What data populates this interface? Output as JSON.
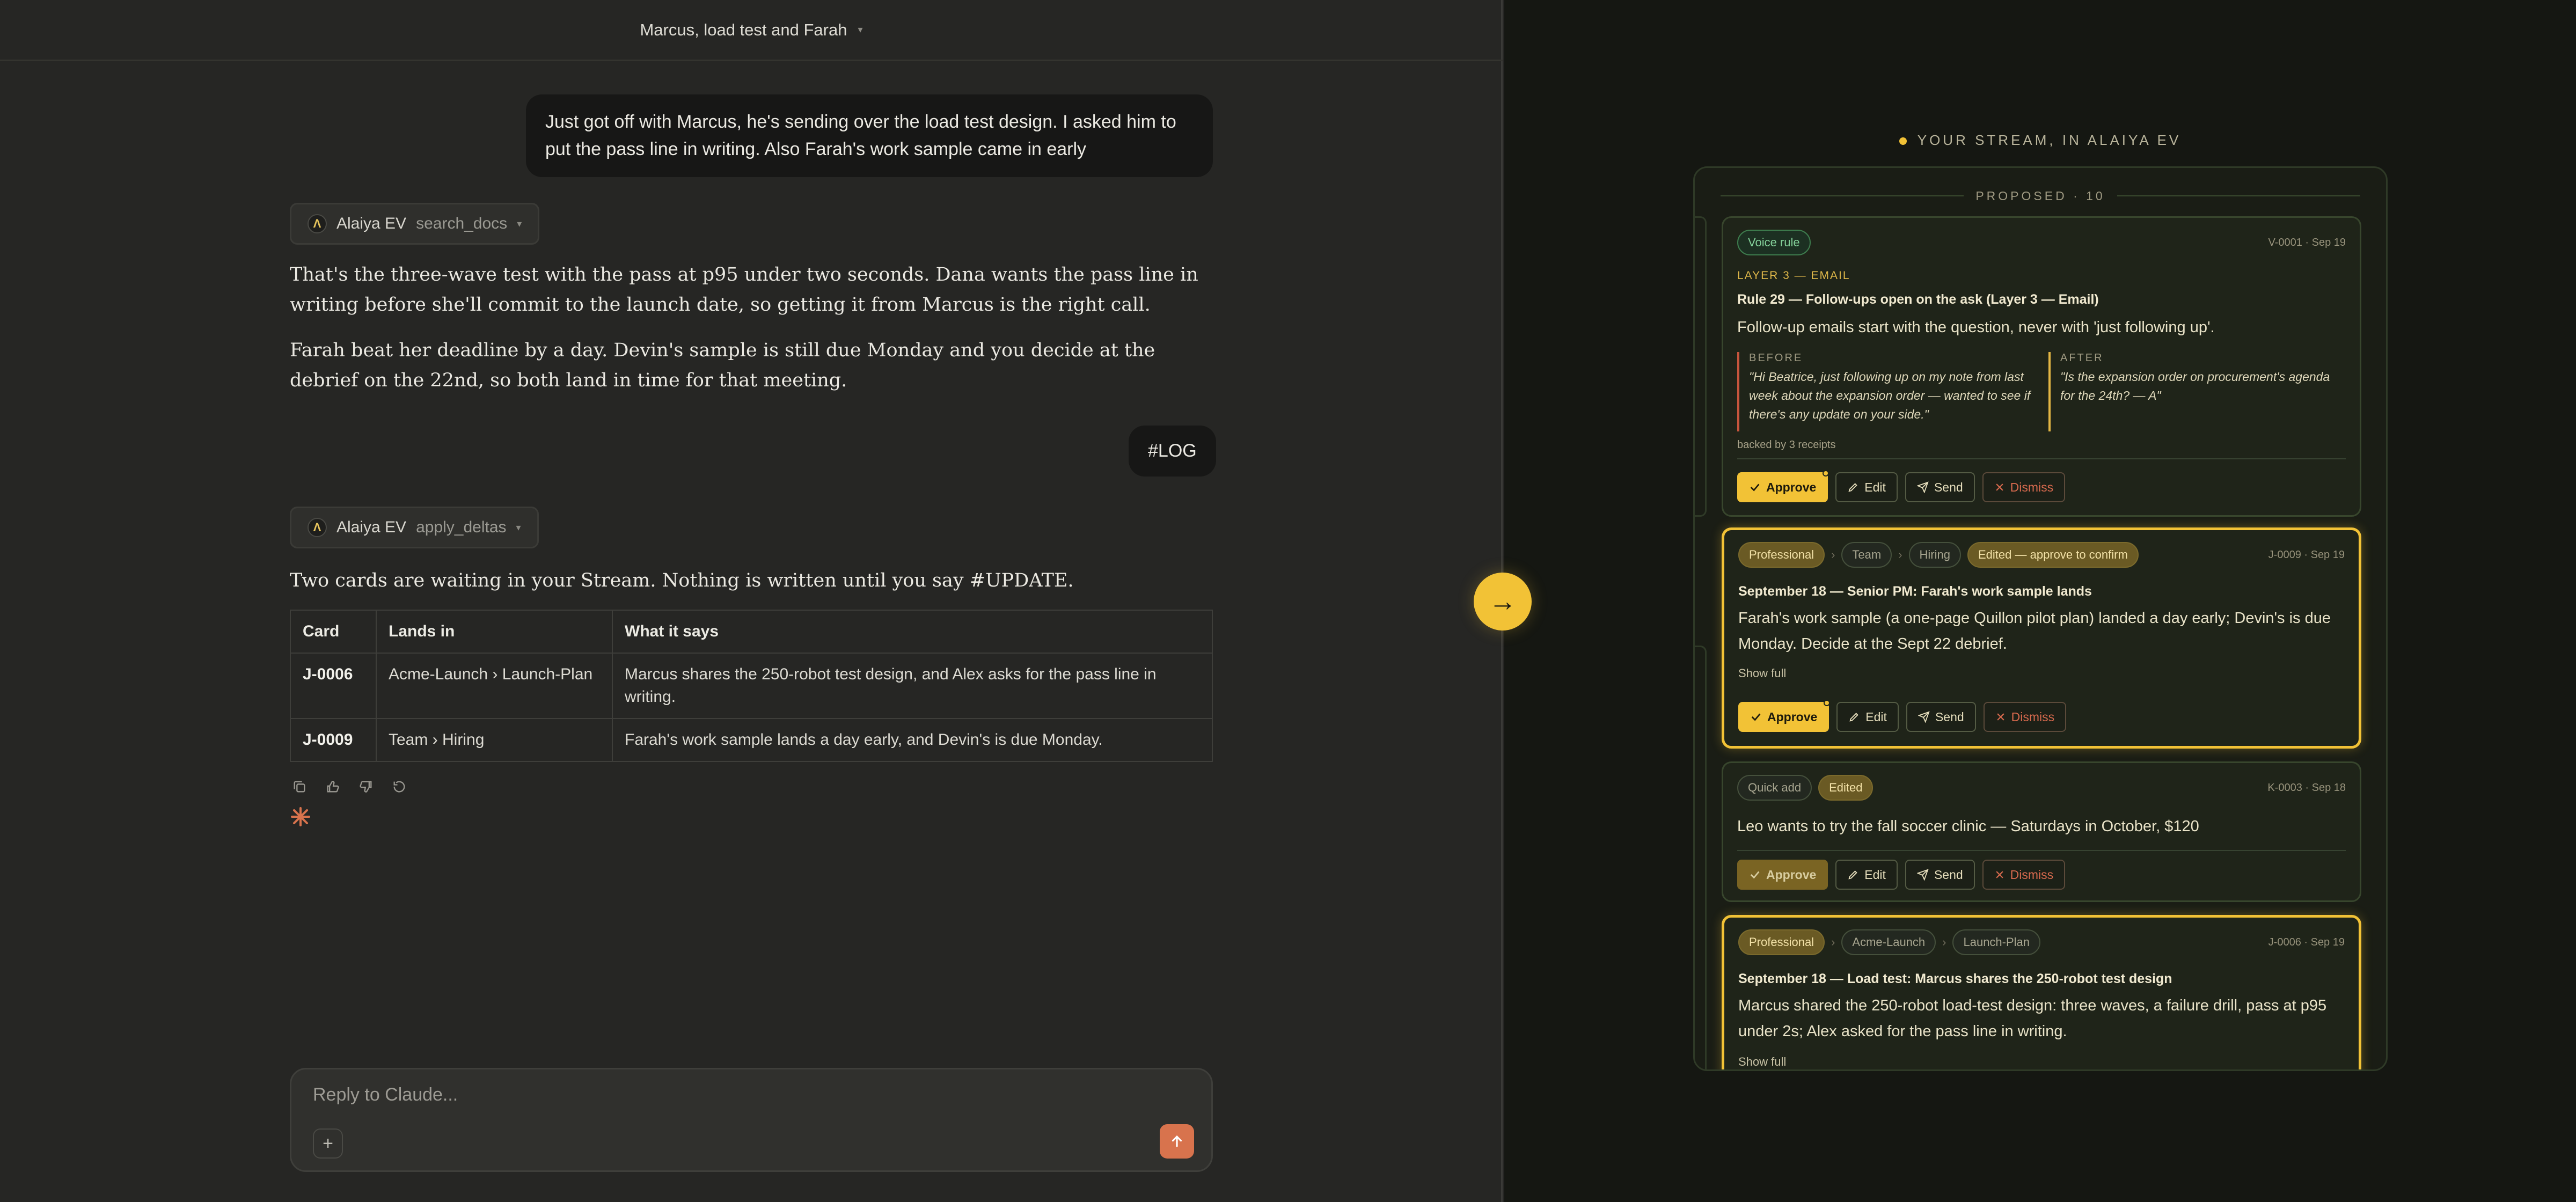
{
  "chat": {
    "title": "Marcus, load test and Farah",
    "user_message_1": "Just got off with Marcus, he's sending over the load test design. I asked him to put the pass line in writing. Also Farah's work sample came in early",
    "tool_1": {
      "agent": "Alaiya EV",
      "function": "search_docs"
    },
    "paragraph_1": "That's the three-wave test with the pass at p95 under two seconds. Dana wants the pass line in writing before she'll commit to the launch date, so getting it from Marcus is the right call.",
    "paragraph_2": "Farah beat her deadline by a day. Devin's sample is still due Monday and you decide at the debrief on the 22nd, so both land in time for that meeting.",
    "user_message_2": "#LOG",
    "tool_2": {
      "agent": "Alaiya EV",
      "function": "apply_deltas"
    },
    "paragraph_3": "Two cards are waiting in your Stream. Nothing is written until you say #UPDATE.",
    "table": {
      "headers": [
        "Card",
        "Lands in",
        "What it says"
      ],
      "rows": [
        [
          "J-0006",
          "Acme-Launch › Launch-Plan",
          "Marcus shares the 250-robot test design, and Alex asks for the pass line in writing."
        ],
        [
          "J-0009",
          "Team › Hiring",
          "Farah's work sample lands a day early, and Devin's is due Monday."
        ]
      ]
    },
    "composer_placeholder": "Reply to Claude...",
    "plus_label": "+"
  },
  "arrow_label": "→",
  "stream": {
    "heading": "YOUR STREAM, IN ALAIYA EV",
    "proposed_label": "PROPOSED · 10",
    "cards": [
      {
        "chips": [
          "Voice rule"
        ],
        "id": "V-0001 · Sep 19",
        "layer": "LAYER 3 — EMAIL",
        "title": "Rule 29 — Follow-ups open on the ask (Layer 3 — Email)",
        "body": "Follow-up emails start with the question, never with 'just following up'.",
        "before_label": "BEFORE",
        "before_text": "\"Hi Beatrice, just following up on my note from last week about the expansion order — wanted to see if there's any update on your side.\"",
        "after_label": "AFTER",
        "after_text": "\"Is the expansion order on procurement's agenda for the 24th? — A\"",
        "backed": "backed by 3 receipts"
      },
      {
        "chips": [
          "Professional",
          "Team",
          "Hiring",
          "Edited — approve to confirm"
        ],
        "id": "J-0009 · Sep 19",
        "title": "September 18 — Senior PM: Farah's work sample lands",
        "body": "Farah's work sample (a one-page Quillon pilot plan) landed a day early; Devin's is due Monday. Decide at the Sept 22 debrief.",
        "show_full": "Show full"
      },
      {
        "chips": [
          "Quick add",
          "Edited"
        ],
        "id": "K-0003 · Sep 18",
        "body": "Leo wants to try the fall soccer clinic — Saturdays in October, $120"
      },
      {
        "chips": [
          "Professional",
          "Acme-Launch",
          "Launch-Plan"
        ],
        "id": "J-0006 · Sep 19",
        "title": "September 18 — Load test: Marcus shares the 250-robot test design",
        "body": "Marcus shared the 250-robot load-test design: three waves, a failure drill, pass at p95 under 2s; Alex asked for the pass line in writing.",
        "show_full": "Show full"
      }
    ],
    "buttons": {
      "approve": "Approve",
      "edit": "Edit",
      "send": "Send",
      "dismiss": "Dismiss"
    }
  },
  "colors": {
    "accent": "#f2c236",
    "send_button": "#d8734d",
    "panel_bg": "#151712"
  }
}
